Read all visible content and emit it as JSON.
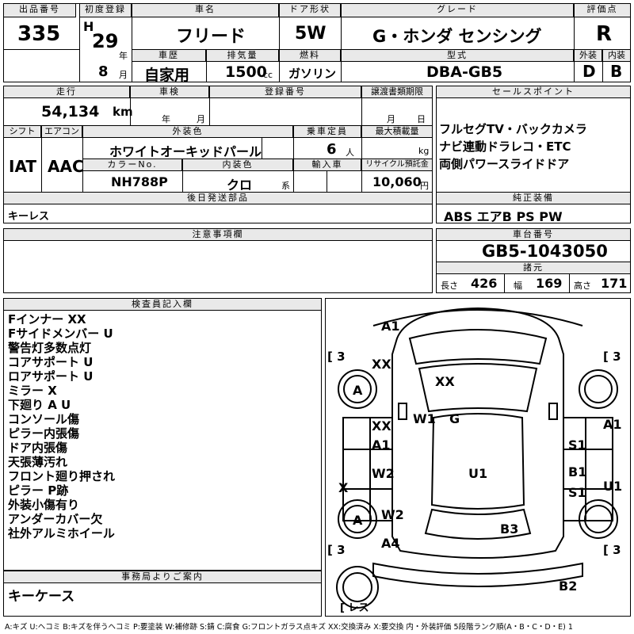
{
  "row1": {
    "h_lot": "出品番号",
    "lot": "335",
    "h_reg": "初度登録",
    "era": "H",
    "year": "29",
    "year_unit": "年",
    "month": "8",
    "month_unit": "月",
    "h_name": "車名",
    "name": "フリード",
    "h_doors": "ドア形状",
    "doors": "5W",
    "h_grade": "グレード",
    "grade": "G・ホンダ センシング",
    "h_score": "評価点",
    "score": "R",
    "h_history": "車歴",
    "history": "自家用",
    "h_cc": "排気量",
    "cc": "1500",
    "cc_unit": "cc",
    "h_fuel": "燃料",
    "fuel": "ガソリン",
    "h_model": "型式",
    "model": "DBA-GB5",
    "h_ext": "外装",
    "ext": "D",
    "h_int": "内装",
    "int": "B"
  },
  "row2": {
    "h_mileage": "走行",
    "mileage": "54,134",
    "mileage_unit": "km",
    "h_inspection": "車検",
    "insp_year": "年",
    "insp_month": "月",
    "h_plate": "登録番号",
    "h_transfer": "譲渡書類期限",
    "tr_month": "月",
    "tr_day": "日",
    "h_shift": "シフト",
    "shift": "IAT",
    "h_ac": "エアコン",
    "ac": "AAC",
    "h_color": "外装色",
    "color": "ホワイトオーキッドパール",
    "h_capacity": "乗車定員",
    "capacity": "6",
    "capacity_unit": "人",
    "h_load": "最大積載量",
    "load_unit": "kg",
    "h_colorno": "カラーNo.",
    "colorno": "NH788P",
    "h_intcolor": "内装色",
    "intcolor": "クロ",
    "intcolor_unit": "系",
    "h_import": "輸入車",
    "h_recycle": "リサイクル預託金",
    "recycle": "10,060",
    "recycle_unit": "円",
    "h_later": "後日発送部品",
    "later": "キーレス"
  },
  "sales": {
    "h": "セールスポイント",
    "lines": [
      "フルセグTV・バックカメラ",
      "ナビ連動ドラレコ・ETC",
      "両側パワースライドドア"
    ]
  },
  "equipment": {
    "h": "純正装備",
    "value": "ABS エアB PS PW"
  },
  "notes": {
    "h": "注意事項欄"
  },
  "chassis": {
    "h": "車台番号",
    "value": "GB5-1043050",
    "h_dims": "諸元",
    "len_label": "長さ",
    "len": "426",
    "wid_label": "幅",
    "wid": "169",
    "hei_label": "高さ",
    "hei": "171"
  },
  "inspector": {
    "h": "検査員記入欄",
    "lines": [
      "Fインナー XX",
      "Fサイドメンバー U",
      "警告灯多数点灯",
      "コアサポート U",
      "ロアサポート U",
      "ミラー X",
      "下廻り A U",
      "コンソール傷",
      "ピラー内張傷",
      "ドア内張傷",
      "天張薄汚れ",
      "フロント廻り押され",
      "ピラー P跡",
      "外装小傷有り",
      "アンダーカバー欠",
      "社外アルミホイール"
    ]
  },
  "office": {
    "h": "事務局よりご案内",
    "value": "キーケース"
  },
  "diagram": {
    "tire_fl": "[ 3",
    "tire_fr": "[ 3",
    "tire_rl": "[ 3",
    "tire_rr": "[ 3",
    "spare": "[ レス",
    "marks": {
      "a1_top": "A1",
      "xx_hood_left": "XX",
      "xx_hood": "XX",
      "a_wheel_fl": "A",
      "xx_fender": "XX",
      "w1": "W1",
      "g": "G",
      "a1_door_l": "A1",
      "a1_right": "A1",
      "s1_door_r": "S1",
      "x_left": "X",
      "w2_door_l": "W2",
      "u1": "U1",
      "b1": "B1",
      "s1_r2": "S1",
      "u1_right": "U1",
      "a_wheel_rl": "A",
      "w2_rear": "W2",
      "b3": "B3",
      "a4": "A4",
      "b2": "B2"
    }
  },
  "legend": "A:キズ U:ヘコミ B:キズを伴うヘコミ P:要塗装 W:補修跡 S:錆 C:腐食 G:フロントガラス点キズ XX:交換済み X:要交換 内・外装評価 5段階ランク順(A・B・C・D・E) 1"
}
